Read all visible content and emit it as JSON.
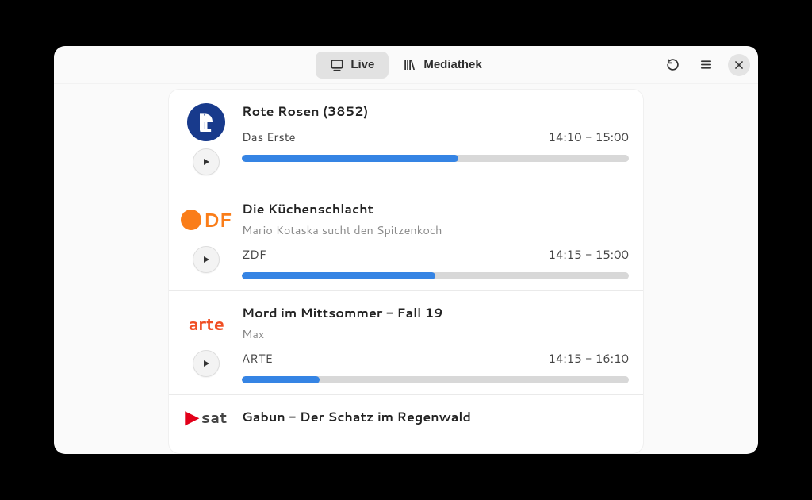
{
  "header": {
    "tabs": {
      "live": "Live",
      "mediathek": "Mediathek"
    }
  },
  "channels": [
    {
      "logo": "ard",
      "title": "Rote Rosen (3852)",
      "subtitle": "",
      "channel": "Das Erste",
      "time": "14:10 - 15:00",
      "progress": 56
    },
    {
      "logo": "zdf",
      "title": "Die Küchenschlacht",
      "subtitle": "Mario Kotaska sucht den Spitzenkoch",
      "channel": "ZDF",
      "time": "14:15 - 15:00",
      "progress": 50
    },
    {
      "logo": "arte",
      "title": "Mord im Mittsommer - Fall 19",
      "subtitle": "Max",
      "channel": "ARTE",
      "time": "14:15 - 16:10",
      "progress": 20
    },
    {
      "logo": "3sat",
      "title": "Gabun - Der Schatz im Regenwald",
      "subtitle": "",
      "channel": "",
      "time": "",
      "progress": 0
    }
  ]
}
